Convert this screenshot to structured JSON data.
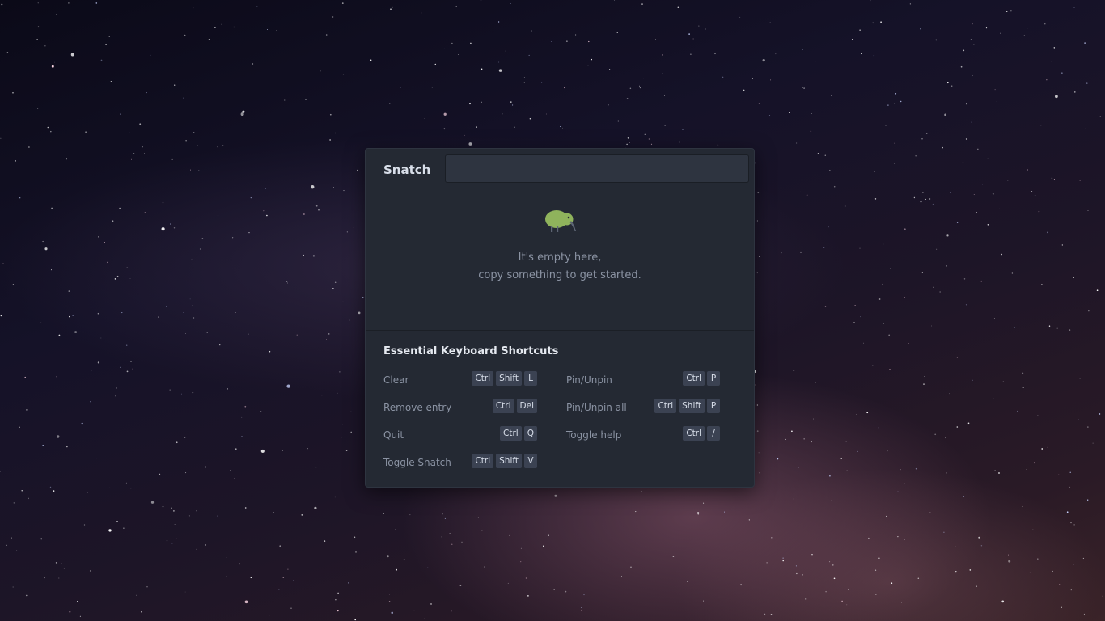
{
  "app": {
    "title": "Snatch"
  },
  "search": {
    "value": "",
    "placeholder": ""
  },
  "empty_state": {
    "icon": "kiwi-bird-icon",
    "line1": "It's empty here,",
    "line2": "copy something to get started."
  },
  "shortcuts": {
    "title": "Essential Keyboard Shortcuts",
    "left": [
      {
        "label": "Clear",
        "keys": [
          "Ctrl",
          "Shift",
          "L"
        ]
      },
      {
        "label": "Remove entry",
        "keys": [
          "Ctrl",
          "Del"
        ]
      },
      {
        "label": "Quit",
        "keys": [
          "Ctrl",
          "Q"
        ]
      },
      {
        "label": "Toggle Snatch",
        "keys": [
          "Ctrl",
          "Shift",
          "V"
        ]
      }
    ],
    "right": [
      {
        "label": "Pin/Unpin",
        "keys": [
          "Ctrl",
          "P"
        ]
      },
      {
        "label": "Pin/Unpin all",
        "keys": [
          "Ctrl",
          "Shift",
          "P"
        ]
      },
      {
        "label": "Toggle help",
        "keys": [
          "Ctrl",
          "/"
        ]
      }
    ]
  },
  "colors": {
    "window_bg": "#242933",
    "input_bg": "#2e3440",
    "kbd_bg": "#3b4252",
    "kiwi_green": "#8fb35c",
    "text_muted": "#8b93a3"
  }
}
